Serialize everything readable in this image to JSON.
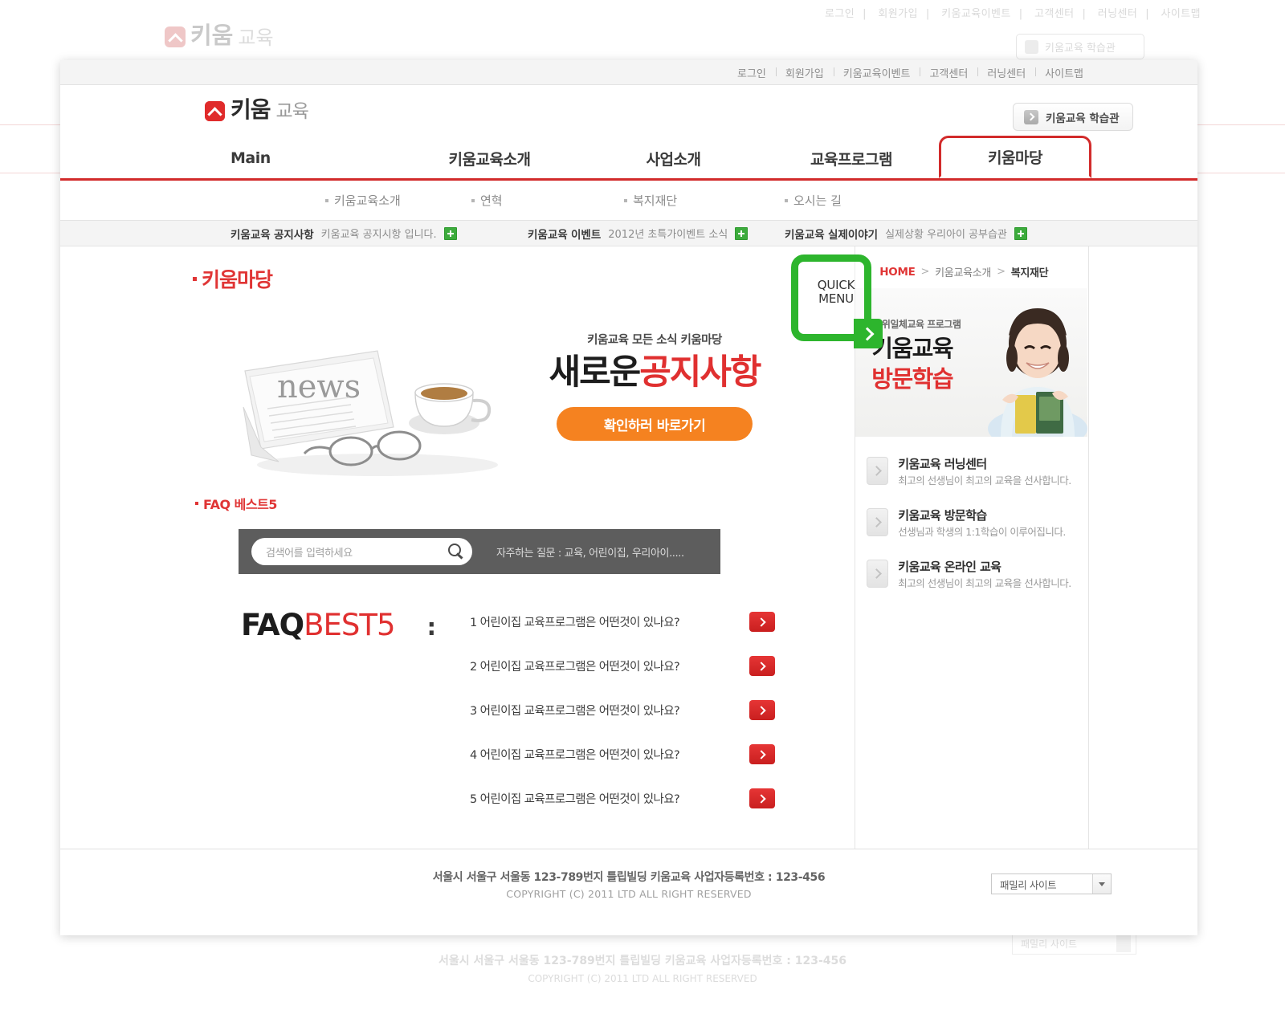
{
  "utility_nav": [
    "로그인",
    "회원가입",
    "키움교육이벤트",
    "고객센터",
    "러닝센터",
    "사이트맵"
  ],
  "brand": {
    "name_bold": "키움",
    "name_light": "교육",
    "logo_icon": "up-chevron-icon"
  },
  "header": {
    "learning_center_button": "키움교육 학습관"
  },
  "main_nav": [
    {
      "label": "Main",
      "active": false
    },
    {
      "label": "키움교육소개",
      "active": false
    },
    {
      "label": "사업소개",
      "active": false
    },
    {
      "label": "교육프로그램",
      "active": false
    },
    {
      "label": "키움마당",
      "active": true
    }
  ],
  "sub_nav": [
    "키움교육소개",
    "연혁",
    "복지재단",
    "오시는 길"
  ],
  "notices": [
    {
      "title_bold": "키움교육",
      "title_rest": "공지사항",
      "text": "키움교육 공지시항 입니다."
    },
    {
      "title_bold": "키움교육",
      "title_rest": "이벤트",
      "text": "2012년 초특가이벤트 소식"
    },
    {
      "title_bold": "키움교육",
      "title_rest": "실제이야기",
      "text": "실제상황 우리아이 공부습관"
    }
  ],
  "page": {
    "title": "키움마당"
  },
  "breadcrumb": {
    "home": "HOME",
    "middle": "키움교육소개",
    "current": "복지재단"
  },
  "quick_menu": {
    "line1": "QUICK",
    "line2": "MENU"
  },
  "hero": {
    "kicker": "키움교육 모든 소식 키움마당",
    "title_black": "새로운",
    "title_red": "공지사항",
    "cta": "확인하러 바로가기",
    "news_image_word": "news"
  },
  "faq": {
    "label": "FAQ 베스트5",
    "search_placeholder": "검색어를 입력하세요",
    "search_value": "",
    "search_hint": "자주하는 질문 : 교육, 어린이집, 우리아이.....",
    "head_black": "FAQ",
    "head_red": "BEST5",
    "colon": ":",
    "items": [
      "1 어린이집 교육프로그램은 어떤것이 있나요?",
      "2 어린이집 교육프로그램은 어떤것이 있나요?",
      "3 어린이집 교육프로그램은 어떤것이 있나요?",
      "4 어린이집 교육프로그램은 어떤것이 있나요?",
      "5 어린이집 교육프로그램은 어떤것이 있나요?"
    ]
  },
  "right_banner": {
    "kicker": "삼위일체교육 프로그램",
    "line1": "키움교육",
    "line2": "방문학습"
  },
  "right_list": [
    {
      "title": "키움교육 러닝센터",
      "desc": "최고의 선생님이 최고의 교육을 선사합니다."
    },
    {
      "title": "키움교육 방문학습",
      "desc": "선생님과 학생의 1:1학습이 이루어집니다."
    },
    {
      "title": "키움교육 온라인 교육",
      "desc": "최고의 선생님이 최고의 교육을 선사합니다."
    }
  ],
  "footer": {
    "address": "서울시 서울구 서울동 123-789번지 틀립빌딩 키움교육 사업자등록번호 : 123-456",
    "copyright": "COPYRIGHT (C) 2011 LTD ALL RIGHT RESERVED",
    "family_site": "패밀리 사이트"
  },
  "colors": {
    "accent_red": "#d22b2b",
    "cta_orange": "#f58220",
    "quick_green": "#2db52d",
    "plus_green": "#3cab3c"
  }
}
